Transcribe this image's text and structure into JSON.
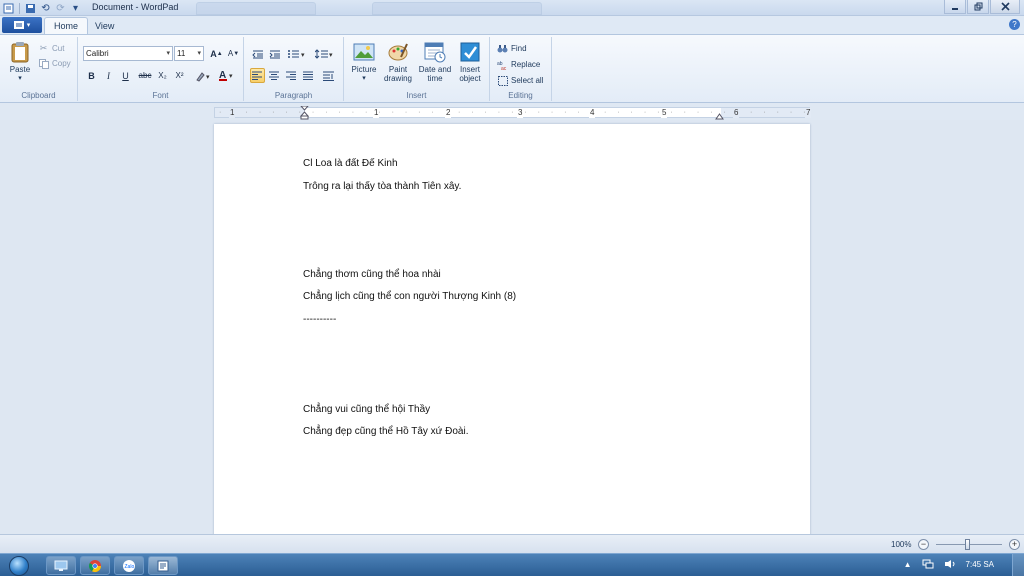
{
  "window": {
    "title": "Document - WordPad"
  },
  "qat": {
    "undo_arrow": "⟲",
    "dropdown": "▾"
  },
  "tabs": [
    {
      "label": "Home"
    },
    {
      "label": "View"
    }
  ],
  "ribbon": {
    "clipboard": {
      "label": "Clipboard",
      "paste": "Paste",
      "cut": "Cut",
      "copy": "Copy"
    },
    "font": {
      "label": "Font",
      "family": "Calibri",
      "size": "11",
      "bold": "B",
      "italic": "I",
      "underline": "U",
      "strike": "abc",
      "subscript": "X₂",
      "superscript": "X²",
      "grow": "A",
      "shrink": "A"
    },
    "paragraph": {
      "label": "Paragraph"
    },
    "insert": {
      "label": "Insert",
      "picture": "Picture",
      "paint_drawing_1": "Paint",
      "paint_drawing_2": "drawing",
      "date_time_1": "Date and",
      "date_time_2": "time",
      "insert_object_1": "Insert",
      "insert_object_2": "object"
    },
    "editing": {
      "label": "Editing",
      "find": "Find",
      "replace": "Replace",
      "select_all": "Select all"
    }
  },
  "ruler": {
    "numbers": [
      "1",
      "1",
      "2",
      "3",
      "4",
      "5",
      "6",
      "7"
    ]
  },
  "document": {
    "lines": [
      "Cl Loa là đất Đế Kinh",
      "Trông ra lại thấy tòa thành Tiên xây.",
      "Chẳng thơm cũng thể hoa nhài",
      "Chẳng lịch cũng thể con người Thượng Kinh (8)",
      "----------",
      "Chẳng vui cũng thể hội Thầy",
      "Chẳng đẹp cũng thể Hồ Tây xứ Đoài."
    ]
  },
  "status": {
    "zoom": "100%",
    "zoom_minus": "−",
    "zoom_plus": "+"
  },
  "taskbar": {
    "clock": "7:45 SA"
  },
  "colors": {
    "ribbon_bg": "#e3ecf7",
    "active_format": "#f8cf6a",
    "taskbar": "#2b5e94"
  }
}
